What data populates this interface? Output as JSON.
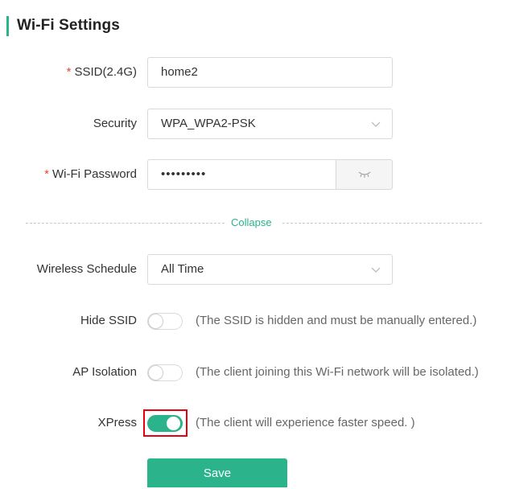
{
  "section": {
    "title": "Wi-Fi Settings"
  },
  "colors": {
    "accent": "#2bb38b",
    "required": "#e8453c",
    "highlight_border": "#e60012"
  },
  "form": {
    "ssid": {
      "required_mark": "*",
      "label": "SSID(2.4G)",
      "value": "home2"
    },
    "security": {
      "label": "Security",
      "value": "WPA_WPA2-PSK",
      "icon": "chevron-down-icon"
    },
    "password": {
      "required_mark": "*",
      "label": "Wi-Fi Password",
      "masked_value": "•••••••••",
      "toggle_icon": "eye-closed-icon"
    },
    "collapse_label": "Collapse",
    "schedule": {
      "label": "Wireless Schedule",
      "value": "All Time",
      "icon": "chevron-down-icon"
    },
    "hide_ssid": {
      "label": "Hide SSID",
      "enabled": false,
      "hint": "(The SSID is hidden and must be manually entered.)"
    },
    "ap_isolation": {
      "label": "AP Isolation",
      "enabled": false,
      "hint": "(The client joining this Wi-Fi network will be isolated.)"
    },
    "xpress": {
      "label": "XPress",
      "enabled": true,
      "highlighted": true,
      "hint": "(The client will experience faster speed. )"
    },
    "save_label": "Save"
  }
}
